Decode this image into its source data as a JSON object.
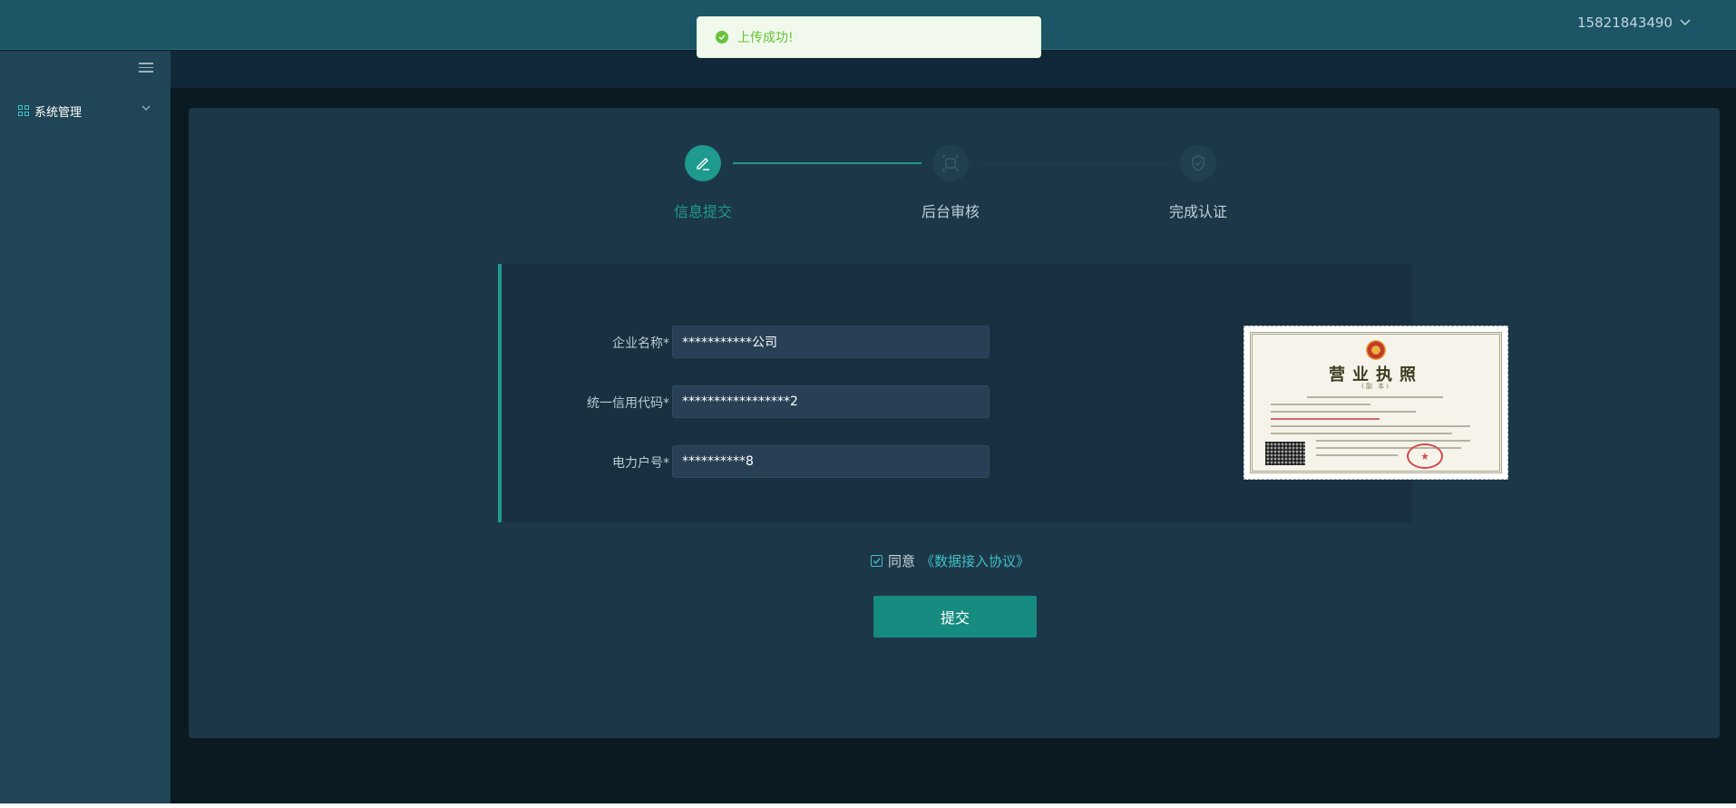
{
  "header": {
    "user_phone": "15821843490",
    "icons": {
      "dropdown": "chevron-down-icon"
    }
  },
  "toast": {
    "message": "上传成功!",
    "icon": "success-check-icon",
    "color": "#67c23a"
  },
  "sidebar": {
    "toggle_icon": "hamburger-menu-icon",
    "items": [
      {
        "label": "系统管理",
        "icon": "grid-icon",
        "expand_icon": "chevron-down-icon"
      }
    ]
  },
  "steps": [
    {
      "label": "信息提交",
      "icon": "edit-pen-icon",
      "status": "active"
    },
    {
      "label": "后台审核",
      "icon": "review-icon",
      "status": "pending"
    },
    {
      "label": "完成认证",
      "icon": "shield-check-icon",
      "status": "pending"
    }
  ],
  "form": {
    "fields": [
      {
        "label": "企业名称*",
        "value": "***********公司"
      },
      {
        "label": "统一信用代码*",
        "value": "*****************2"
      },
      {
        "label": "电力户号*",
        "value": "**********8"
      }
    ],
    "license_image": {
      "title": "营业执照",
      "subtitle": "(副 本)"
    }
  },
  "agreement": {
    "checked": true,
    "text": "同意",
    "link": "《数据接入协议》"
  },
  "submit_label": "提交",
  "colors": {
    "accent": "#1f9a8e",
    "header": "#1b5566",
    "sidebar": "#1f4556",
    "card": "#1c3748"
  }
}
